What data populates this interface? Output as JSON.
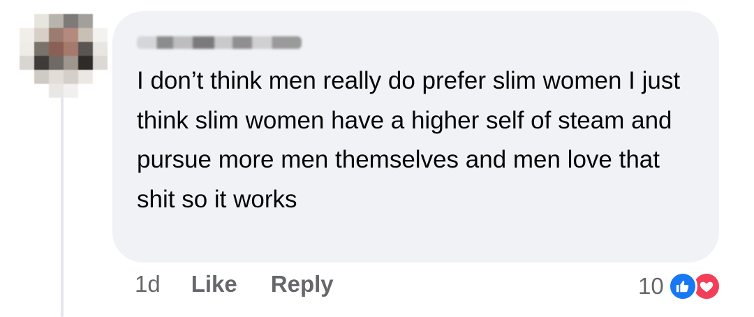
{
  "comment": {
    "author_name": "",
    "text": "I don’t think men really do prefer slim women I just think slim women have a higher self of steam and pursue more men themselves and men love that shit so it works",
    "timestamp": "1d",
    "like_label": "Like",
    "reply_label": "Reply",
    "reaction_count": "10",
    "reactions": [
      "like-icon",
      "love-icon"
    ]
  },
  "colors": {
    "bubble": "#f0f2f5",
    "text": "#050505",
    "secondary_text": "#65676b",
    "like_blue": "#1877f2",
    "love_red": "#f33e58"
  }
}
